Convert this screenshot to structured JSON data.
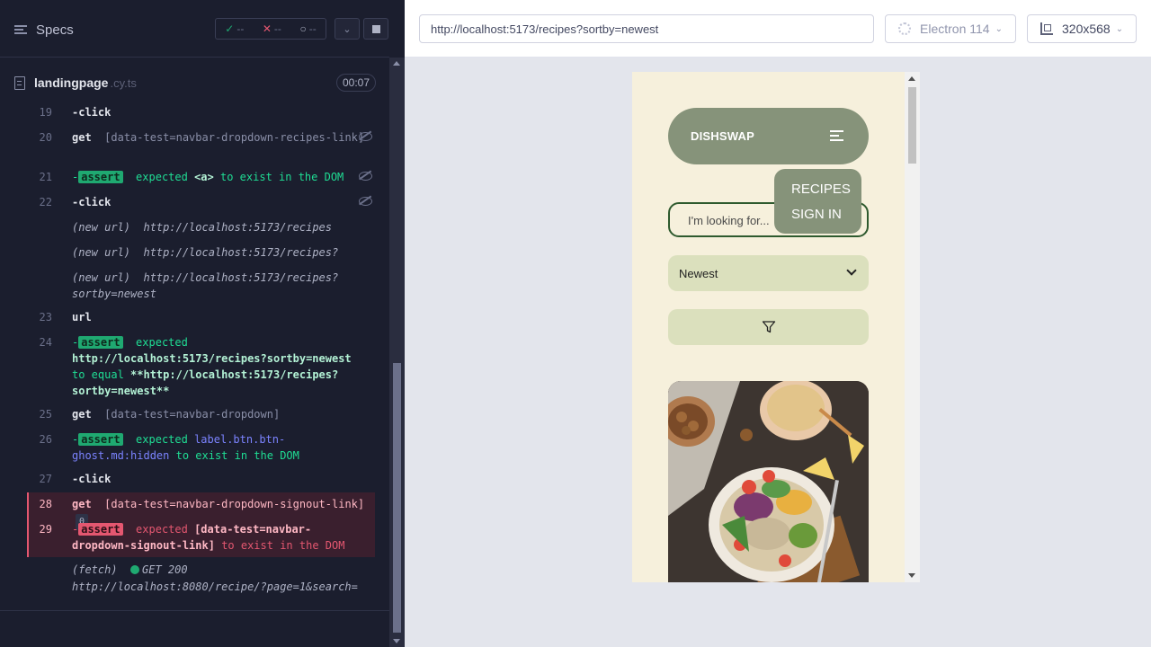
{
  "left_panel": {
    "specs_label": "Specs",
    "stats": {
      "passed": "--",
      "failed": "--",
      "pending": "--"
    },
    "spec_file": {
      "name": "landingpage",
      "ext": ".cy.ts",
      "duration": "00:07"
    },
    "commands": [
      {
        "line": "19",
        "name": "-click"
      },
      {
        "line": "20",
        "name": "get",
        "msg": "[data-test=navbar-dropdown-recipes-link]"
      },
      {
        "line": "21",
        "tag": "assert",
        "msg_a": "expected",
        "msg_b": "<a>",
        "msg_c": "to exist in the DOM"
      },
      {
        "line": "22",
        "name": "-click"
      },
      {
        "new_url_label": "(new url)",
        "url1": "http://localhost:5173/recipes",
        "url2": "http://localhost:5173/recipes?",
        "url3": "http://localhost:5173/recipes?sortby=newest"
      },
      {
        "line": "23",
        "name": "url"
      },
      {
        "line": "24",
        "tag": "assert",
        "msg_a": "expected",
        "msg_b": "http://localhost:5173/recipes?sortby=newest",
        "msg_c": "to equal",
        "msg_d": "**http://localhost:5173/recipes?sortby=newest**"
      },
      {
        "line": "25",
        "name": "get",
        "msg": "[data-test=navbar-dropdown]"
      },
      {
        "line": "26",
        "tag": "assert",
        "msg_a": "expected",
        "msg_b": "label.btn.btn-ghost.md:hidden",
        "msg_c": "to exist in the DOM"
      },
      {
        "line": "27",
        "name": "-click"
      },
      {
        "line": "28",
        "name": "get",
        "msg": "[data-test=navbar-dropdown-signout-link]",
        "badge": "0"
      },
      {
        "line": "29",
        "tag": "assert",
        "msg_a": "expected",
        "msg_b": "[data-test=navbar-dropdown-signout-link]",
        "msg_c": "to exist in the DOM"
      },
      {
        "fetch_label": "(fetch)",
        "status": "GET 200",
        "url": "http://localhost:8080/recipe/?page=1&search="
      }
    ]
  },
  "topbar": {
    "url": "http://localhost:5173/recipes?sortby=newest",
    "browser": "Electron 114",
    "viewport": "320x568"
  },
  "app": {
    "brand": "DISHSWAP",
    "menu": {
      "recipes": "RECIPES",
      "signin": "SIGN IN"
    },
    "search_placeholder": "I'm looking for...",
    "sort_value": "Newest"
  },
  "colors": {
    "runner_bg": "#1b1e2e",
    "pass_green": "#1fa971",
    "fail_red": "#e45770",
    "app_bg": "#f6f0dc",
    "navbar": "#86937a",
    "control_bg": "#dbe0bd",
    "search_border": "#2e5a2e"
  }
}
